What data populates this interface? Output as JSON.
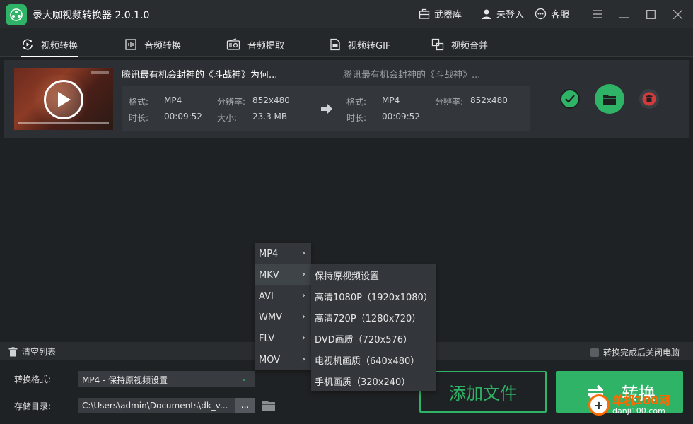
{
  "app": {
    "title": "录大咖视频转换器 2.0.1.0"
  },
  "titlebar": {
    "arsenal": "武器库",
    "login": "未登入",
    "service": "客服"
  },
  "tabs": [
    {
      "label": "视频转换"
    },
    {
      "label": "音频转换"
    },
    {
      "label": "音频提取"
    },
    {
      "label": "视频转GIF"
    },
    {
      "label": "视频合并"
    }
  ],
  "file": {
    "source_name": "腾讯最有机会封神的《斗战神》为何...",
    "target_name": "腾讯最有机会封神的《斗战神》...",
    "source": {
      "format_label": "格式:",
      "format": "MP4",
      "resolution_label": "分辨率:",
      "resolution": "852x480",
      "duration_label": "时长:",
      "duration": "00:09:52",
      "size_label": "大小:",
      "size": "23.3 MB"
    },
    "target": {
      "format_label": "格式:",
      "format": "MP4",
      "resolution_label": "分辨率:",
      "resolution": "852x480",
      "duration_label": "时长:",
      "duration": "00:09:52"
    }
  },
  "bottom": {
    "clear_list": "清空列表",
    "shutdown_label": "转换完成后关闭电脑",
    "format_label": "转换格式:",
    "format_value": "MP4 - 保持原视频设置",
    "dir_label": "存储目录:",
    "dir_value": "C:\\Users\\admin\\Documents\\dk_v...",
    "dots": "...",
    "add_file": "添加文件",
    "convert": "转换"
  },
  "format_menu": {
    "items": [
      "MP4",
      "MKV",
      "AVI",
      "WMV",
      "FLV",
      "MOV"
    ],
    "highlighted": "MKV"
  },
  "quality_menu": {
    "items": [
      "保持原视频设置",
      "高清1080P（1920x1080）",
      "高清720P（1280x720）",
      "DVD画质（720x576）",
      "电视机画质（640x480）",
      "手机画质（320x240）"
    ]
  },
  "watermark": {
    "main": "单机100网",
    "sub": "danji100.com",
    "badge": "+"
  },
  "colors": {
    "accent": "#2fb366",
    "danger": "#d23b3b",
    "bg": "#1f2224"
  }
}
